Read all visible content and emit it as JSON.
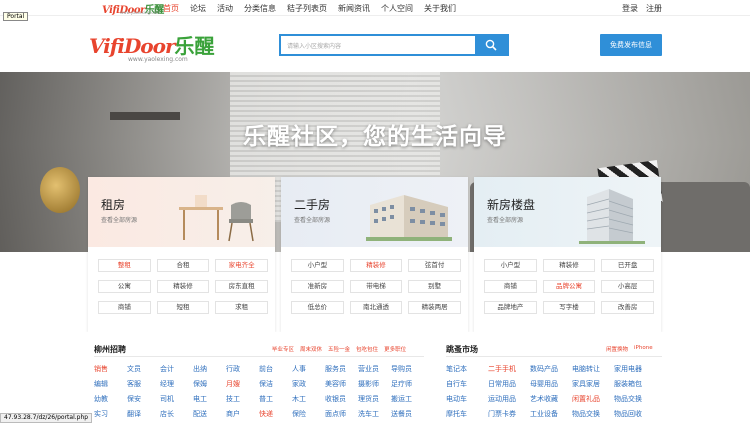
{
  "topnav": {
    "mini_logo_en": "VifiDoor",
    "mini_logo_cn": "乐醒",
    "mini_logo_url": "www.yaolexing.com",
    "links": [
      {
        "label": "首页",
        "active": true
      },
      {
        "label": "论坛",
        "active": false
      },
      {
        "label": "活动",
        "active": false
      },
      {
        "label": "分类信息",
        "active": false
      },
      {
        "label": "秸子列表页",
        "active": false
      },
      {
        "label": "新闻资讯",
        "active": false
      },
      {
        "label": "个人空间",
        "active": false
      },
      {
        "label": "关于我们",
        "active": false
      }
    ],
    "login": "登录",
    "register": "注册",
    "tooltip": "Portal"
  },
  "header": {
    "logo_en": "VifiDoor",
    "logo_cn": "乐醒",
    "logo_url": "www.yaolexing.com",
    "search_placeholder": "请输入小区搜索内容",
    "publish_label": "免费发布信息"
  },
  "hero": {
    "headline": "乐醒社区，您的生活向导"
  },
  "cards": [
    {
      "title": "租房",
      "sub": "查看全部房源",
      "tags": [
        {
          "label": "整租",
          "hot": true
        },
        {
          "label": "合租",
          "hot": false
        },
        {
          "label": "家电齐全",
          "hot": true
        },
        {
          "label": "公寓",
          "hot": false
        },
        {
          "label": "精装修",
          "hot": false
        },
        {
          "label": "房东直租",
          "hot": false
        },
        {
          "label": "商铺",
          "hot": false
        },
        {
          "label": "短租",
          "hot": false
        },
        {
          "label": "求租",
          "hot": false
        }
      ]
    },
    {
      "title": "二手房",
      "sub": "查看全部房源",
      "tags": [
        {
          "label": "小户型",
          "hot": false
        },
        {
          "label": "精装修",
          "hot": true
        },
        {
          "label": "弦首付",
          "hot": false
        },
        {
          "label": "准新房",
          "hot": false
        },
        {
          "label": "带电梯",
          "hot": false
        },
        {
          "label": "别墅",
          "hot": false
        },
        {
          "label": "低总价",
          "hot": false
        },
        {
          "label": "南北通透",
          "hot": false
        },
        {
          "label": "精装两居",
          "hot": false
        }
      ]
    },
    {
      "title": "新房楼盘",
      "sub": "查看全部房源",
      "tags": [
        {
          "label": "小户型",
          "hot": false
        },
        {
          "label": "精装修",
          "hot": false
        },
        {
          "label": "已开盘",
          "hot": false
        },
        {
          "label": "商铺",
          "hot": false
        },
        {
          "label": "品牌公寓",
          "hot": true
        },
        {
          "label": "小高层",
          "hot": false
        },
        {
          "label": "品牌地产",
          "hot": false
        },
        {
          "label": "写字楼",
          "hot": false
        },
        {
          "label": "改善房",
          "hot": false
        }
      ]
    }
  ],
  "jobs": {
    "title": "柳州招聘",
    "links": [
      "毕业专区",
      "周末双休",
      "五险一金",
      "包吃包住",
      "更多职位"
    ],
    "rows": [
      [
        {
          "t": "销售",
          "red": true
        },
        {
          "t": "文员",
          "red": false
        },
        {
          "t": "会计",
          "red": false
        },
        {
          "t": "出纳",
          "red": false
        },
        {
          "t": "行政",
          "red": false
        },
        {
          "t": "前台",
          "red": false
        },
        {
          "t": "人事",
          "red": false
        },
        {
          "t": "服务员",
          "red": false
        },
        {
          "t": "营业员",
          "red": false
        },
        {
          "t": "导购员",
          "red": false
        }
      ],
      [
        {
          "t": "编辑",
          "red": false
        },
        {
          "t": "客服",
          "red": false
        },
        {
          "t": "经理",
          "red": false
        },
        {
          "t": "保姆",
          "red": false
        },
        {
          "t": "月嫂",
          "red": true
        },
        {
          "t": "保洁",
          "red": false
        },
        {
          "t": "家政",
          "red": false
        },
        {
          "t": "美容师",
          "red": false
        },
        {
          "t": "摄影师",
          "red": false
        },
        {
          "t": "足疗师",
          "red": false
        }
      ],
      [
        {
          "t": "幼教",
          "red": false
        },
        {
          "t": "保安",
          "red": false
        },
        {
          "t": "司机",
          "red": false
        },
        {
          "t": "电工",
          "red": false
        },
        {
          "t": "技工",
          "red": false
        },
        {
          "t": "普工",
          "red": false
        },
        {
          "t": "木工",
          "red": false
        },
        {
          "t": "收银员",
          "red": false
        },
        {
          "t": "理货员",
          "red": false
        },
        {
          "t": "搬运工",
          "red": false
        }
      ],
      [
        {
          "t": "实习",
          "red": false
        },
        {
          "t": "翻译",
          "red": false
        },
        {
          "t": "店长",
          "red": false
        },
        {
          "t": "配送",
          "red": false
        },
        {
          "t": "商户",
          "red": false
        },
        {
          "t": "快递",
          "red": true
        },
        {
          "t": "保险",
          "red": false
        },
        {
          "t": "面点师",
          "red": false
        },
        {
          "t": "洗车工",
          "red": false
        },
        {
          "t": "送餐员",
          "red": false
        }
      ]
    ]
  },
  "market": {
    "title": "跳蚤市场",
    "links": [
      "闲置换物",
      "iPhone"
    ],
    "rows": [
      [
        {
          "t": "笔记本",
          "red": false
        },
        {
          "t": "二手手机",
          "red": true
        },
        {
          "t": "数码产品",
          "red": false
        },
        {
          "t": "电脑转让",
          "red": false
        }
      ],
      [
        {
          "t": "自行车",
          "red": false
        },
        {
          "t": "日常用品",
          "red": false
        },
        {
          "t": "母婴用品",
          "red": false
        },
        {
          "t": "家具家居",
          "red": false
        }
      ],
      [
        {
          "t": "电动车",
          "red": false
        },
        {
          "t": "运动用品",
          "red": false
        },
        {
          "t": "艺术收藏",
          "red": false
        },
        {
          "t": "闲置礼品",
          "red": true
        }
      ],
      [
        {
          "t": "摩托车",
          "red": false
        },
        {
          "t": "门票卡券",
          "red": false
        },
        {
          "t": "工业设备",
          "red": false
        },
        {
          "t": "物品交换",
          "red": false
        }
      ]
    ],
    "extra_col": [
      {
        "t": "家用电器",
        "red": false
      },
      {
        "t": "服装箱包",
        "red": false
      },
      {
        "t": "物品交换",
        "red": false
      },
      {
        "t": "物品回收",
        "red": false
      }
    ]
  },
  "status_url": "47.93.28.7/dz/26/portal.php"
}
